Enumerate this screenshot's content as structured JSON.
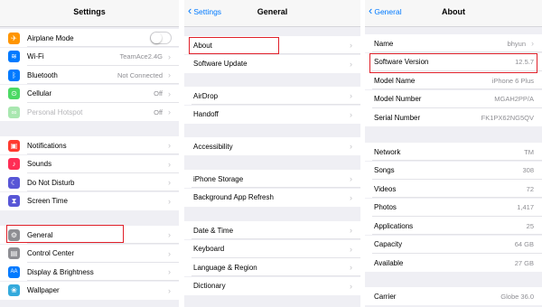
{
  "settings": {
    "title": "Settings",
    "group1": [
      {
        "label": "Airplane Mode",
        "icon": "airplane-icon",
        "color": "#ff9500",
        "glyph": "✈"
      },
      {
        "label": "Wi-Fi",
        "value": "TeamAce2.4G",
        "icon": "wifi-icon",
        "color": "#007aff",
        "glyph": "≋"
      },
      {
        "label": "Bluetooth",
        "value": "Not Connected",
        "icon": "bluetooth-icon",
        "color": "#007aff",
        "glyph": "ᛒ"
      },
      {
        "label": "Cellular",
        "value": "Off",
        "icon": "cellular-icon",
        "color": "#4cd964",
        "glyph": "⊙"
      },
      {
        "label": "Personal Hotspot",
        "value": "Off",
        "icon": "hotspot-icon",
        "color": "#a9e7b0",
        "glyph": "∞"
      }
    ],
    "group2": [
      {
        "label": "Notifications",
        "icon": "notifications-icon",
        "color": "#ff3b30",
        "glyph": "▣"
      },
      {
        "label": "Sounds",
        "icon": "sounds-icon",
        "color": "#ff2d55",
        "glyph": "♪"
      },
      {
        "label": "Do Not Disturb",
        "icon": "moon-icon",
        "color": "#5856d6",
        "glyph": "☾"
      },
      {
        "label": "Screen Time",
        "icon": "hourglass-icon",
        "color": "#5856d6",
        "glyph": "⧗"
      }
    ],
    "group3": [
      {
        "label": "General",
        "icon": "gear-icon",
        "color": "#8e8e93",
        "glyph": "⚙"
      },
      {
        "label": "Control Center",
        "icon": "control-center-icon",
        "color": "#8e8e93",
        "glyph": "▤"
      },
      {
        "label": "Display & Brightness",
        "icon": "display-icon",
        "color": "#007aff",
        "glyph": "AA"
      },
      {
        "label": "Wallpaper",
        "icon": "wallpaper-icon",
        "color": "#34aadc",
        "glyph": "❀"
      }
    ]
  },
  "general": {
    "title": "General",
    "back": "Settings",
    "group1": [
      "About",
      "Software Update"
    ],
    "group2": [
      "AirDrop",
      "Handoff"
    ],
    "group3": [
      "Accessibility"
    ],
    "group4": [
      "iPhone Storage",
      "Background App Refresh"
    ],
    "group5": [
      "Date & Time",
      "Keyboard",
      "Language & Region",
      "Dictionary"
    ]
  },
  "about": {
    "title": "About",
    "back": "General",
    "group1": [
      {
        "label": "Name",
        "value": "bhyun",
        "chevron": true
      },
      {
        "label": "Software Version",
        "value": "12.5.7"
      },
      {
        "label": "Model Name",
        "value": "iPhone 6 Plus"
      },
      {
        "label": "Model Number",
        "value": "MGAH2PP/A"
      },
      {
        "label": "Serial Number",
        "value": "FK1PX62NG5QV"
      }
    ],
    "group2": [
      {
        "label": "Network",
        "value": "TM"
      },
      {
        "label": "Songs",
        "value": "308"
      },
      {
        "label": "Videos",
        "value": "72"
      },
      {
        "label": "Photos",
        "value": "1,417"
      },
      {
        "label": "Applications",
        "value": "25"
      },
      {
        "label": "Capacity",
        "value": "64 GB"
      },
      {
        "label": "Available",
        "value": "27 GB"
      }
    ],
    "group3": [
      {
        "label": "Carrier",
        "value": "Globe 36.0"
      }
    ]
  },
  "colors": {
    "accent": "#007aff",
    "highlight": "#e0202a"
  }
}
